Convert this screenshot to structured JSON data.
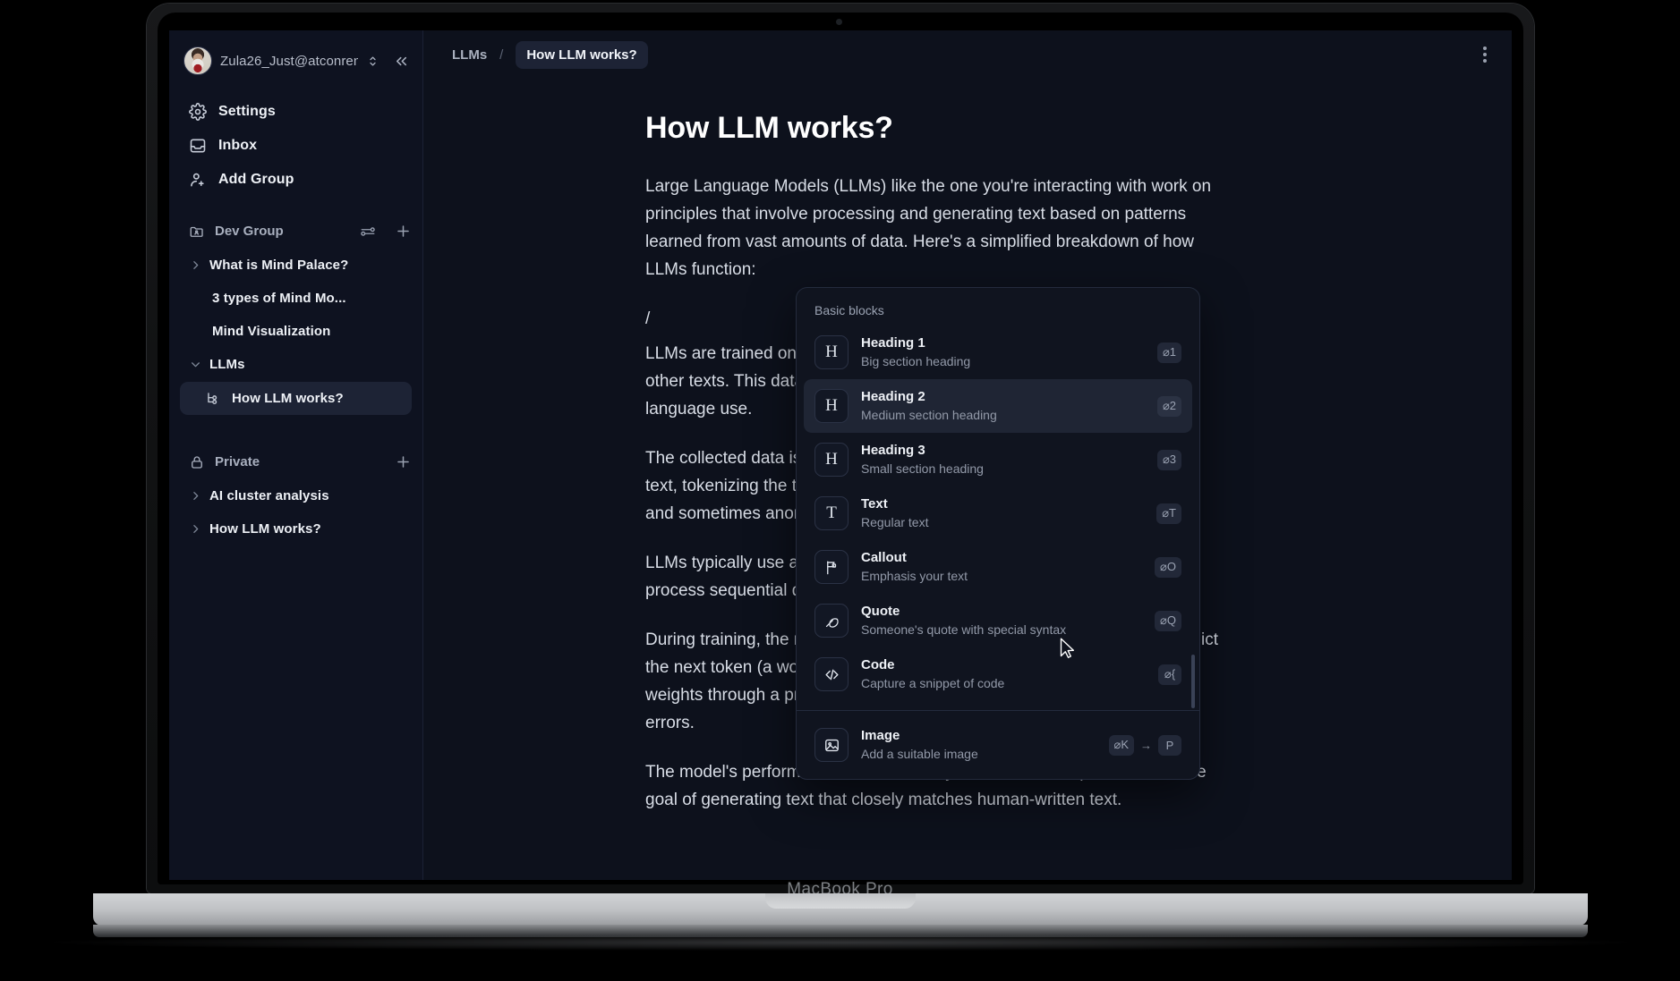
{
  "device": {
    "label": "MacBook Pro"
  },
  "sidebar": {
    "account": {
      "name": "Zula26_Just@atconrent...",
      "avatar_icon": "user-avatar",
      "switch_icon": "chevron-up-down-icon",
      "collapse_icon": "chevrons-left-icon"
    },
    "nav": [
      {
        "label": "Settings",
        "icon": "gear-icon"
      },
      {
        "label": "Inbox",
        "icon": "inbox-icon"
      },
      {
        "label": "Add Group",
        "icon": "user-plus-icon"
      }
    ],
    "groups": [
      {
        "label": "Dev Group",
        "icon": "folder-user-icon",
        "actions": [
          "sliders-icon",
          "plus-icon"
        ],
        "items": [
          {
            "label": "What is Mind Palace?",
            "chevron": "chevron-right-icon",
            "indent": false,
            "selected": false
          },
          {
            "label": "3 types of Mind Mo...",
            "chevron": "",
            "indent": true,
            "selected": false
          },
          {
            "label": "Mind Visualization",
            "chevron": "",
            "indent": true,
            "selected": false
          },
          {
            "label": "LLMs",
            "chevron": "chevron-down-icon",
            "indent": false,
            "selected": false
          },
          {
            "label": "How LLM works?",
            "chevron": "",
            "indent": true,
            "selected": true,
            "icon": "node-tree-icon"
          }
        ]
      },
      {
        "label": "Private",
        "icon": "lock-icon",
        "actions": [
          "plus-icon"
        ],
        "items": [
          {
            "label": "AI cluster analysis",
            "chevron": "chevron-right-icon",
            "indent": false,
            "selected": false
          },
          {
            "label": "How LLM works?",
            "chevron": "chevron-right-icon",
            "indent": false,
            "selected": false
          }
        ]
      }
    ]
  },
  "topbar": {
    "breadcrumb_parent": "LLMs",
    "breadcrumb_sep": "/",
    "breadcrumb_current": "How LLM works?",
    "menu_icon": "kebab-menu-icon"
  },
  "document": {
    "title": "How LLM works?",
    "paragraph_1": "Large Language Models (LLMs) like the one you're interacting with work on principles that involve processing and generating text based on patterns learned from vast amounts of data. Here's a simplified breakdown of how LLMs function:",
    "slash_input": "/",
    "paragraph_2": "LLMs are trained on a large dataset compiled from books, websites, and other texts. This dataset includes a wide range of human knowledge and language use.",
    "paragraph_3": "The collected data is preprocessed for training. This includes cleaning the text, tokenizing the text (breaking down the text into manageable pieces), and sometimes anonymizing sensitive information.",
    "paragraph_4": "LLMs typically use a neural network architecture, often a transformer, to process sequential data and understand the context of language.",
    "paragraph_5": "During training, the model is fed vast sequences of text and learns to predict the next token (a word or part of a word) in the sequence. It adjusts its weights through a process called backpropagation to minimize prediction errors.",
    "paragraph_6": "The model's performance is continuously evaluated and optimized with the goal of generating text that closely matches human-written text."
  },
  "command_menu": {
    "group_label": "Basic blocks",
    "items": [
      {
        "title": "Heading 1",
        "subtitle": "Big section heading",
        "icon": "heading-h-icon",
        "shortcut": [
          "⌀1"
        ],
        "active": false
      },
      {
        "title": "Heading 2",
        "subtitle": "Medium section heading",
        "icon": "heading-h-icon",
        "shortcut": [
          "⌀2"
        ],
        "active": true
      },
      {
        "title": "Heading 3",
        "subtitle": "Small section heading",
        "icon": "heading-h-icon",
        "shortcut": [
          "⌀3"
        ],
        "active": false
      },
      {
        "title": "Text",
        "subtitle": "Regular text",
        "icon": "text-t-icon",
        "shortcut": [
          "⌀T"
        ],
        "active": false
      },
      {
        "title": "Callout",
        "subtitle": "Emphasis your text",
        "icon": "flag-icon",
        "shortcut": [
          "⌀O"
        ],
        "active": false
      },
      {
        "title": "Quote",
        "subtitle": "Someone's quote with special syntax",
        "icon": "feather-icon",
        "shortcut": [
          "⌀Q"
        ],
        "active": false
      },
      {
        "title": "Code",
        "subtitle": "Capture a snippet of code",
        "icon": "code-brackets-icon",
        "shortcut": [
          "⌀{"
        ],
        "active": false
      },
      {
        "title": "Image",
        "subtitle": "Add a suitable image",
        "icon": "image-icon",
        "shortcut": [
          "⌀K",
          "→",
          "P"
        ],
        "active": false
      }
    ]
  },
  "colors": {
    "app_background": "#0d111c",
    "sidebar_background": "#0e1220",
    "selected_row": "#1d2335",
    "menu_background": "#10141f",
    "menu_active_row": "#1f2534",
    "text_primary": "#eef1f6",
    "text_muted": "#9aa2b2"
  }
}
